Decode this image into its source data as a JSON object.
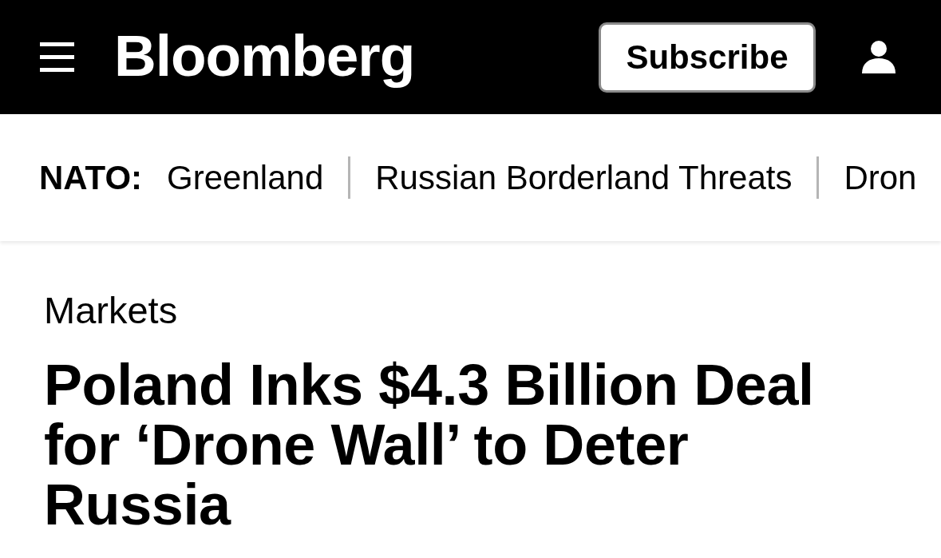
{
  "header": {
    "logo": "Bloomberg",
    "subscribe_button": "Subscribe"
  },
  "topic_nav": {
    "label": "NATO:",
    "items": [
      "Greenland",
      "Russian Borderland Threats",
      "Dron"
    ]
  },
  "article": {
    "section": "Markets",
    "headline": "Poland Inks $4.3 Billion Deal for ‘Drone Wall’ to Deter Russia"
  }
}
